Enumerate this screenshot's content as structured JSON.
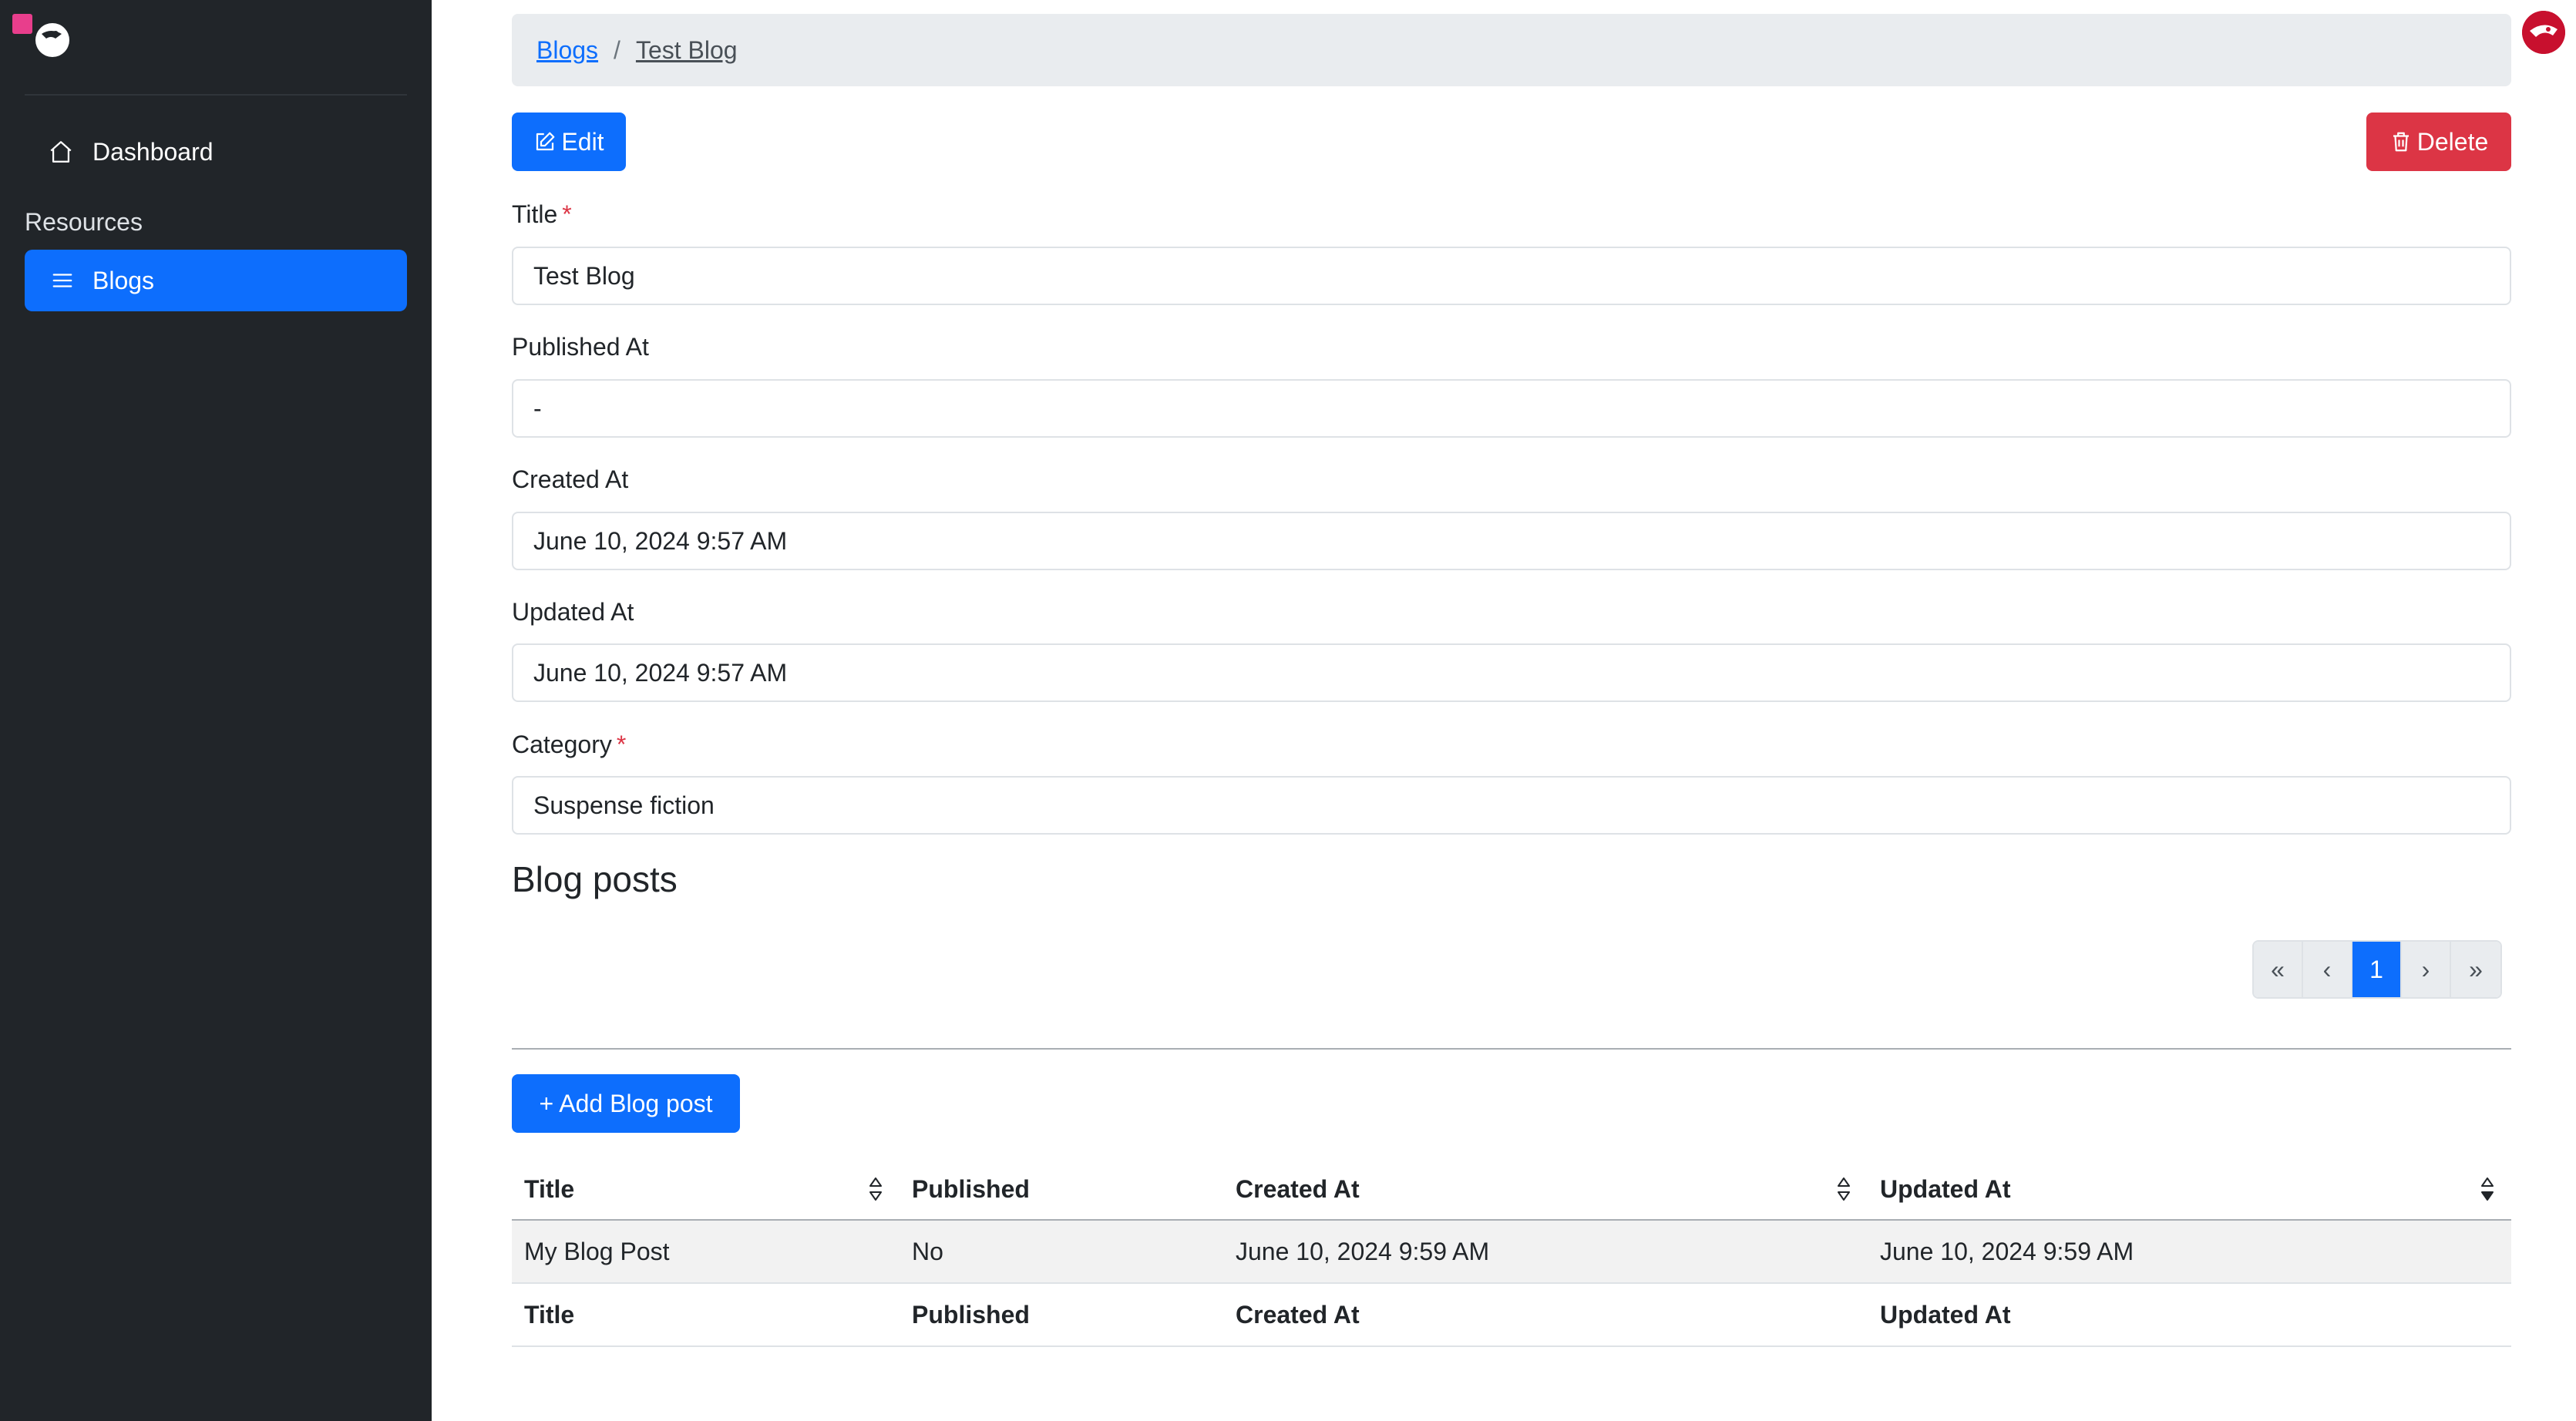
{
  "sidebar": {
    "logo_icon": "logo-icon",
    "items": [
      {
        "label": "Dashboard",
        "icon": "home-icon"
      },
      {
        "label": "Blogs",
        "icon": "list-icon",
        "active": true
      }
    ],
    "section_label": "Resources"
  },
  "breadcrumb": {
    "root": "Blogs",
    "separator": "/",
    "current": "Test Blog"
  },
  "actions": {
    "edit_label": "Edit",
    "delete_label": "Delete"
  },
  "fields": [
    {
      "label": "Title",
      "required": true,
      "value": "Test Blog"
    },
    {
      "label": "Published At",
      "required": false,
      "value": "-"
    },
    {
      "label": "Created At",
      "required": false,
      "value": "June 10, 2024 9:57 AM"
    },
    {
      "label": "Updated At",
      "required": false,
      "value": "June 10, 2024 9:57 AM"
    },
    {
      "label": "Category",
      "required": true,
      "value": "Suspense fiction"
    }
  ],
  "required_mark": "*",
  "blog_posts": {
    "title": "Blog posts",
    "pagination": {
      "first": "«",
      "prev": "‹",
      "current": "1",
      "next": "›",
      "last": "»"
    },
    "add_label": "+ Add Blog post",
    "columns": [
      "Title",
      "Published",
      "Created At",
      "Updated At"
    ],
    "rows": [
      [
        "My Blog Post",
        "No",
        "June 10, 2024 9:59 AM",
        "June 10, 2024 9:59 AM"
      ]
    ],
    "footer": [
      "Title",
      "Published",
      "Created At",
      "Updated At"
    ]
  },
  "colors": {
    "primary": "#0d6efd",
    "danger": "#dc3545",
    "sidebar": "#212529"
  }
}
